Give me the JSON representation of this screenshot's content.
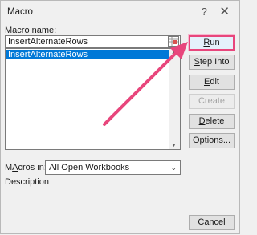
{
  "window": {
    "title": "Macro",
    "help_glyph": "?",
    "close_glyph": "✕"
  },
  "macro_name": {
    "label": "Macro name:",
    "label_accel": "M",
    "label_rest": "acro name:",
    "value": "InsertAlternateRows"
  },
  "macro_list": {
    "items": [
      "InsertAlternateRows"
    ],
    "selected_index": 0
  },
  "buttons": {
    "run": {
      "accel": "R",
      "rest": "un",
      "label": "Run"
    },
    "step_into": {
      "accel": "S",
      "rest": "tep Into",
      "label": "Step Into"
    },
    "edit": {
      "accel": "E",
      "rest": "dit",
      "label": "Edit"
    },
    "create": {
      "label": "Create",
      "enabled": false
    },
    "delete": {
      "accel": "D",
      "rest": "elete",
      "label": "Delete"
    },
    "options": {
      "accel": "O",
      "rest": "ptions...",
      "label": "Options..."
    },
    "cancel": {
      "label": "Cancel"
    }
  },
  "macros_in": {
    "label": "Macros in:",
    "label_accel": "A",
    "label_pre": "M",
    "label_post": "cros in:",
    "value": "All Open Workbooks"
  },
  "description": {
    "label": "Description"
  },
  "annotation": {
    "arrow_color": "#e8467c"
  },
  "colors": {
    "selection": "#0078d7",
    "highlight": "#e8467c"
  }
}
